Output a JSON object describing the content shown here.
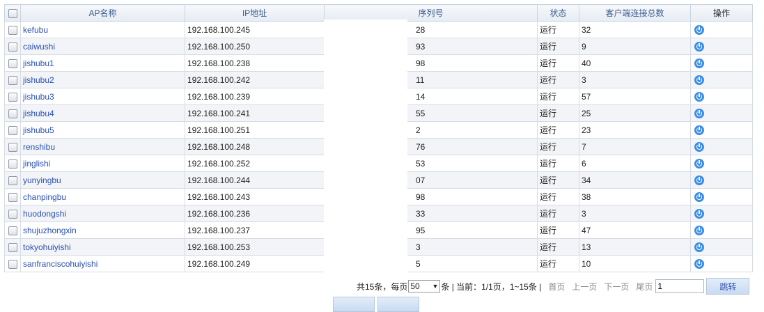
{
  "table": {
    "headers": {
      "name": "AP名称",
      "ip": "IP地址",
      "serial": "序列号",
      "status": "状态",
      "clients": "客户端连接总数",
      "action": "操作"
    },
    "rows": [
      {
        "name": "kefubu",
        "ip": "192.168.100.245",
        "serial": "28",
        "status": "运行",
        "clients": "32"
      },
      {
        "name": "caiwushi",
        "ip": "192.168.100.250",
        "serial": "93",
        "status": "运行",
        "clients": "9"
      },
      {
        "name": "jishubu1",
        "ip": "192.168.100.238",
        "serial": "98",
        "status": "运行",
        "clients": "40"
      },
      {
        "name": "jishubu2",
        "ip": "192.168.100.242",
        "serial": "11",
        "status": "运行",
        "clients": "3"
      },
      {
        "name": "jishubu3",
        "ip": "192.168.100.239",
        "serial": "14",
        "status": "运行",
        "clients": "57"
      },
      {
        "name": "jishubu4",
        "ip": "192.168.100.241",
        "serial": "55",
        "status": "运行",
        "clients": "25"
      },
      {
        "name": "jishubu5",
        "ip": "192.168.100.251",
        "serial": "2",
        "status": "运行",
        "clients": "23"
      },
      {
        "name": "renshibu",
        "ip": "192.168.100.248",
        "serial": "76",
        "status": "运行",
        "clients": "7"
      },
      {
        "name": "jinglishi",
        "ip": "192.168.100.252",
        "serial": "53",
        "status": "运行",
        "clients": "6"
      },
      {
        "name": "yunyingbu",
        "ip": "192.168.100.244",
        "serial": "07",
        "status": "运行",
        "clients": "34"
      },
      {
        "name": "chanpingbu",
        "ip": "192.168.100.243",
        "serial": "98",
        "status": "运行",
        "clients": "38"
      },
      {
        "name": "huodongshi",
        "ip": "192.168.100.236",
        "serial": "33",
        "status": "运行",
        "clients": "3"
      },
      {
        "name": "shujuzhongxin",
        "ip": "192.168.100.237",
        "serial": "95",
        "status": "运行",
        "clients": "47"
      },
      {
        "name": "tokyohuiyishi",
        "ip": "192.168.100.253",
        "serial": "3",
        "status": "运行",
        "clients": "13"
      },
      {
        "name": "sanfranciscohuiyishi",
        "ip": "192.168.100.249",
        "serial": "5",
        "status": "运行",
        "clients": "10"
      }
    ]
  },
  "pager": {
    "total_text": "共15条，每页",
    "page_size": "50",
    "current_text": "条 | 当前：1/1页，1~15条 |",
    "first": "首页",
    "prev": "上一页",
    "next": "下一页",
    "last": "尾页",
    "jump_value": "1",
    "jump_label": "跳转"
  },
  "icons": {
    "row_action": "power-icon",
    "checkbox": "checkbox-icon"
  },
  "colors": {
    "link": "#2a50b0",
    "header_text": "#3d5e90",
    "power_icon": "#3a8ee6"
  }
}
